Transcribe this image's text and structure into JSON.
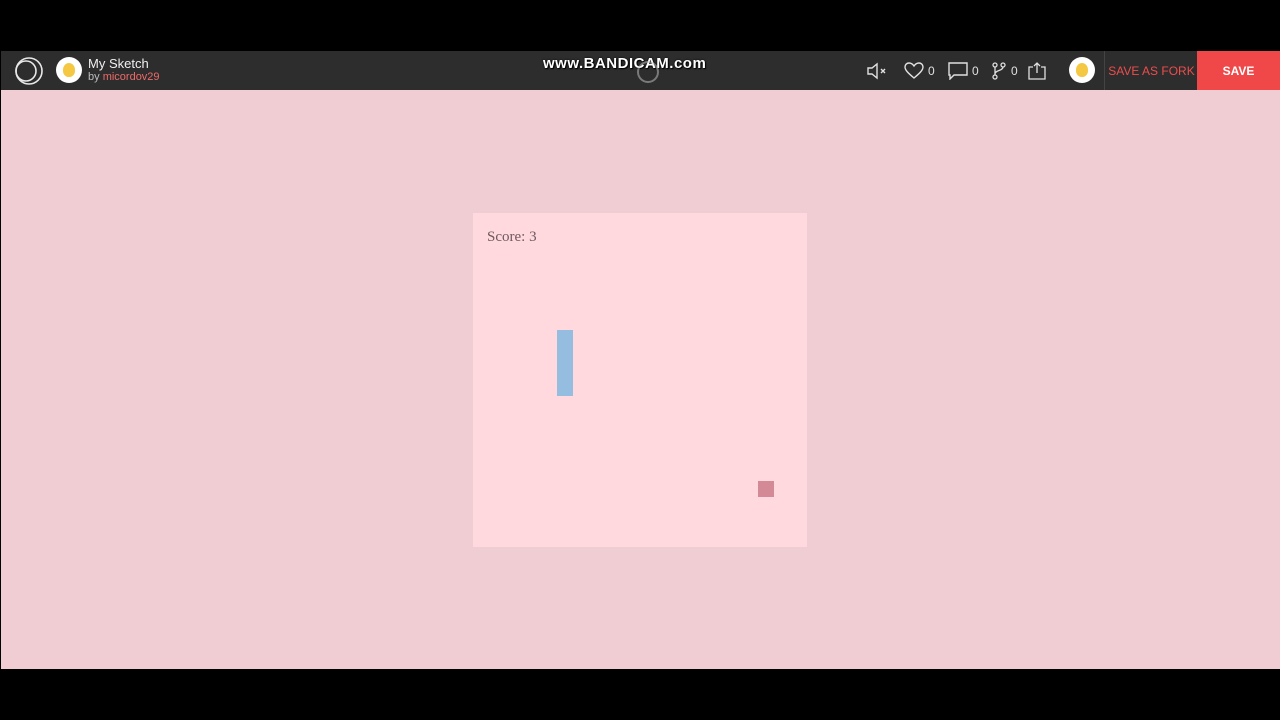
{
  "header": {
    "sketch_title": "My Sketch",
    "by_label": "by",
    "author": "micordov29",
    "watermark": "www.BANDICAM.com",
    "likes_count": "0",
    "comments_count": "0",
    "forks_count": "0",
    "save_as_fork_label": "SAVE AS FORK",
    "save_label": "SAVE",
    "icons": {
      "logo": "openprocessing-logo-icon",
      "mute": "speaker-muted-icon",
      "likes": "heart-icon",
      "comments": "comment-icon",
      "forks": "fork-icon",
      "share": "share-icon"
    }
  },
  "game": {
    "score_label": "Score: 3"
  },
  "colors": {
    "topbar": "#2d2d2d",
    "save_button": "#f04848",
    "stage_background": "#efcdd3",
    "canvas_background": "#ffd9de",
    "paddle": "#94bde0",
    "food": "#d48a96"
  }
}
